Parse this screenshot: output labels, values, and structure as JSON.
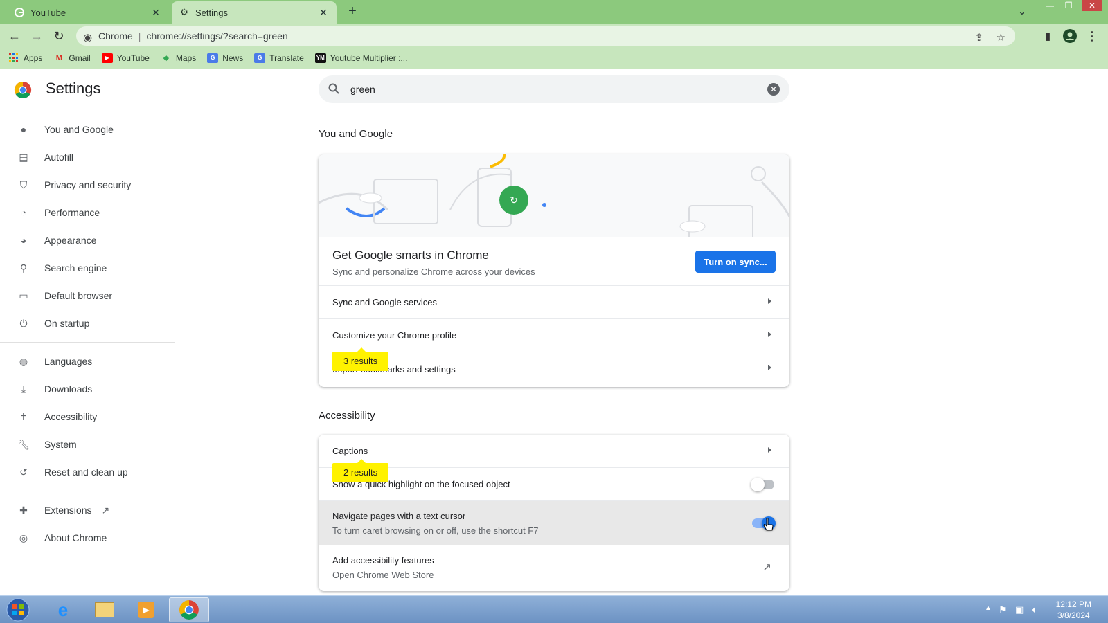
{
  "browser": {
    "tabs": [
      {
        "title": "YouTube",
        "active": false
      },
      {
        "title": "Settings",
        "active": true
      }
    ],
    "omnibox": {
      "site": "Chrome",
      "url": "chrome://settings/?search=green"
    },
    "bookmarks": [
      {
        "label": "Apps",
        "icon": "apps-grid-icon"
      },
      {
        "label": "Gmail",
        "icon": "gmail-icon"
      },
      {
        "label": "YouTube",
        "icon": "youtube-icon"
      },
      {
        "label": "Maps",
        "icon": "maps-icon"
      },
      {
        "label": "News",
        "icon": "news-icon"
      },
      {
        "label": "Translate",
        "icon": "translate-icon"
      },
      {
        "label": "Youtube Multiplier :...",
        "icon": "ym-icon"
      }
    ]
  },
  "settings": {
    "title": "Settings",
    "nav": [
      {
        "label": "You and Google",
        "icon": "person-icon"
      },
      {
        "label": "Autofill",
        "icon": "clipboard-icon"
      },
      {
        "label": "Privacy and security",
        "icon": "shield-icon"
      },
      {
        "label": "Performance",
        "icon": "speedometer-icon"
      },
      {
        "label": "Appearance",
        "icon": "palette-icon"
      },
      {
        "label": "Search engine",
        "icon": "search-icon"
      },
      {
        "label": "Default browser",
        "icon": "browser-icon"
      },
      {
        "label": "On startup",
        "icon": "power-icon"
      },
      {
        "label": "Languages",
        "icon": "globe-icon"
      },
      {
        "label": "Downloads",
        "icon": "download-icon"
      },
      {
        "label": "Accessibility",
        "icon": "accessibility-icon"
      },
      {
        "label": "System",
        "icon": "wrench-icon"
      },
      {
        "label": "Reset and clean up",
        "icon": "history-icon"
      },
      {
        "label": "Extensions",
        "icon": "puzzle-icon"
      },
      {
        "label": "About Chrome",
        "icon": "chrome-icon"
      }
    ],
    "search": {
      "value": "green"
    },
    "you_and_google": {
      "section_title": "You and Google",
      "smarts_heading": "Get Google smarts in Chrome",
      "smarts_sub": "Sync and personalize Chrome across your devices",
      "sync_button": "Turn on sync...",
      "rows": [
        "Sync and Google services",
        "Customize your Chrome profile",
        "Import bookmarks and settings"
      ],
      "results_bubble": "3 results"
    },
    "accessibility": {
      "section_title": "Accessibility",
      "captions": "Captions",
      "highlight": "Show a quick highlight on the focused object",
      "highlight_on": false,
      "caret_title": "Navigate pages with a text cursor",
      "caret_sub": "To turn caret browsing on or off, use the shortcut F7",
      "caret_on": true,
      "add_title": "Add accessibility features",
      "add_sub": "Open Chrome Web Store",
      "results_bubble": "2 results"
    }
  },
  "taskbar": {
    "time": "12:12 PM",
    "date": "3/8/2024"
  },
  "colors": {
    "accent": "#1a73e8",
    "frame": "#8cc97d",
    "highlight": "#fff200"
  }
}
